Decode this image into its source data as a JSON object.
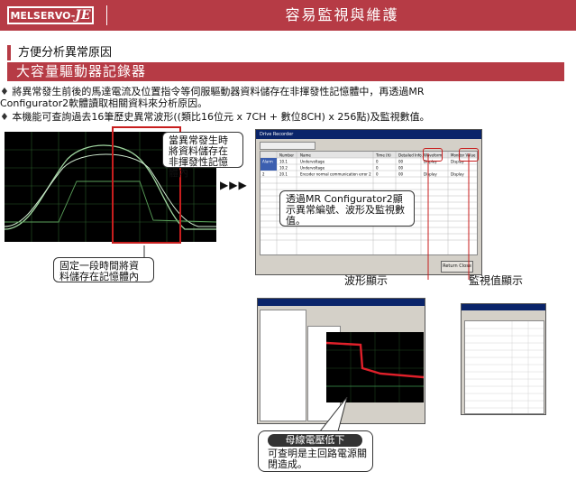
{
  "header": {
    "logo_prefix": "MELSERVO-",
    "logo_suffix": "JE",
    "title": "容易監視與維護"
  },
  "section": {
    "subtitle": "方便分析異常原因",
    "title": "大容量驅動器記錄器"
  },
  "bullets": [
    {
      "marker": "♦",
      "line1": "將異常發生前後的馬達電流及位置指令等伺服驅動器資料儲存在非揮發性記憶體中，再透過MR",
      "line2": "Configurator2軟體讀取相關資料來分析原因。"
    },
    {
      "marker": "♦",
      "line1": "本機能可查詢過去16筆歷史異常波形((類比16位元 x 7CH + 數位8CH) x 256點)及監視數值。"
    }
  ],
  "callouts": {
    "alarm_store": "當異常發生時將資料儲存在非揮發性記憶體內",
    "fixed_store": "固定一段時間將資料儲存在記憶體內",
    "mr_display": "透過MR Configurator2顯示異常編號、波形及監視數值。",
    "bus_title": "母線電壓低下",
    "bus_desc": "可查明是主回路電源關閉造成。"
  },
  "arrows": "▶▶▶",
  "labels": {
    "waveform": "波形顯示",
    "monitor": "監視值顯示"
  },
  "drive_recorder": {
    "title": "Drive Recorder",
    "headers": [
      "",
      "Number",
      "Name",
      "Time (h)",
      "Detailed Info.",
      "Waveform",
      "Monitor Value"
    ],
    "rows": [
      [
        "Alarm",
        "10.1",
        "Undervoltage",
        "0",
        "00",
        "Display",
        "Display"
      ],
      [
        "",
        "10.2",
        "Undervoltage",
        "0",
        "00",
        "",
        ""
      ],
      [
        "2",
        "20.1",
        "Encoder normal communication error 2",
        "0",
        "00",
        "Display",
        "Display"
      ]
    ],
    "ok_label": "Return Close"
  },
  "colors": {
    "brand": "#b63b45",
    "highlight": "#c81e1e"
  }
}
